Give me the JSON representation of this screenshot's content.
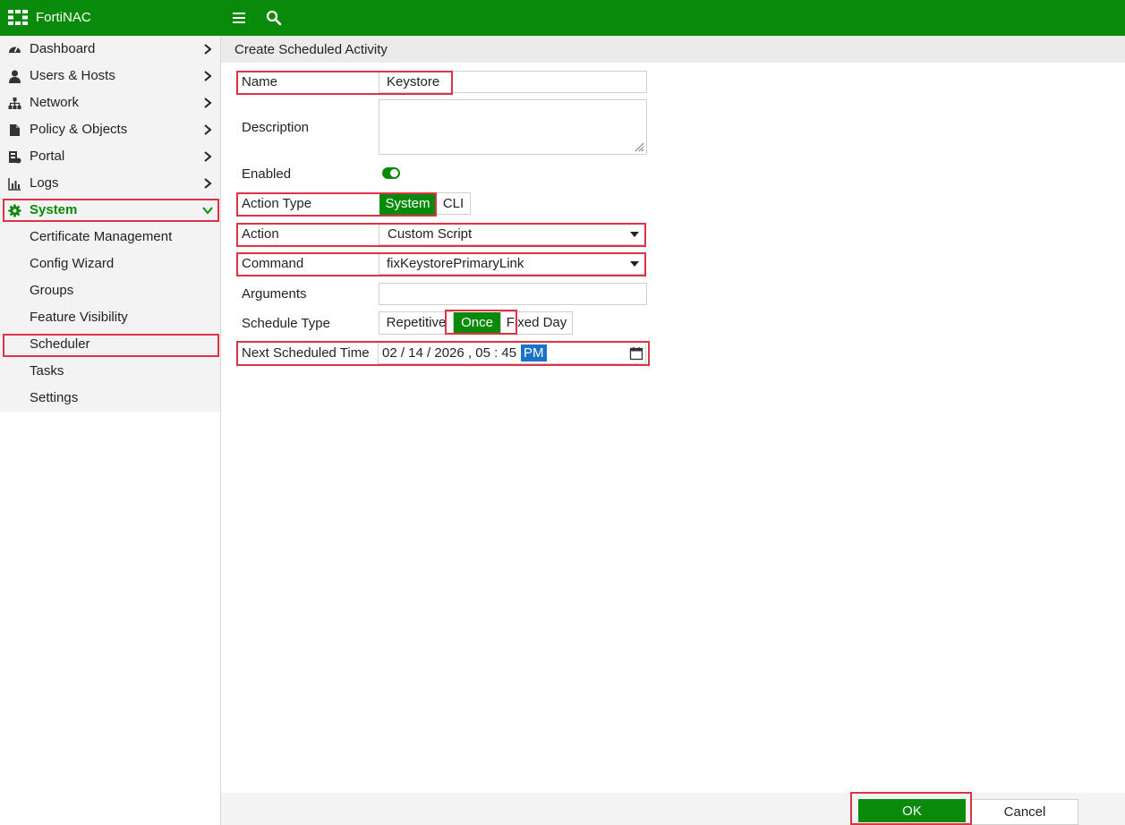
{
  "app": {
    "title": "FortiNAC",
    "logo_icon": "fortinet-grid-icon"
  },
  "topbar": {
    "menu_icon": "hamburger-icon",
    "search_icon": "search-icon"
  },
  "colors": {
    "brand_green": "#0a8a0a",
    "highlight_red": "#dd3344",
    "selection_blue": "#1a73c8"
  },
  "sidebar": {
    "items": [
      {
        "label": "Dashboard",
        "icon": "dashboard-gauge-icon"
      },
      {
        "label": "Users & Hosts",
        "icon": "user-icon"
      },
      {
        "label": "Network",
        "icon": "network-tree-icon"
      },
      {
        "label": "Policy & Objects",
        "icon": "policy-document-icon"
      },
      {
        "label": "Portal",
        "icon": "portal-icon"
      },
      {
        "label": "Logs",
        "icon": "bar-chart-icon"
      },
      {
        "label": "System",
        "icon": "gear-icon"
      }
    ],
    "system_subitems": [
      {
        "label": "Certificate Management"
      },
      {
        "label": "Config Wizard"
      },
      {
        "label": "Groups"
      },
      {
        "label": "Feature Visibility"
      },
      {
        "label": "Scheduler"
      },
      {
        "label": "Tasks"
      },
      {
        "label": "Settings"
      }
    ]
  },
  "page": {
    "title": "Create Scheduled Activity"
  },
  "form": {
    "name": {
      "label": "Name",
      "value": "Keystore"
    },
    "description": {
      "label": "Description",
      "value": ""
    },
    "enabled": {
      "label": "Enabled"
    },
    "action_type": {
      "label": "Action Type",
      "options": [
        "System",
        "CLI"
      ],
      "selected": "System"
    },
    "action": {
      "label": "Action",
      "value": "Custom Script"
    },
    "command": {
      "label": "Command",
      "value": "fixKeystorePrimaryLink"
    },
    "arguments": {
      "label": "Arguments",
      "value": ""
    },
    "schedule_type": {
      "label": "Schedule Type",
      "options": [
        "Repetitive",
        "Once",
        "Fixed Day"
      ],
      "selected": "Once"
    },
    "next_scheduled_time": {
      "label": "Next Scheduled Time",
      "date": "02 / 14 / 2026 ,  05 : 45",
      "ampm": "PM",
      "icon": "calendar-icon"
    }
  },
  "footer": {
    "ok_label": "OK",
    "cancel_label": "Cancel"
  }
}
